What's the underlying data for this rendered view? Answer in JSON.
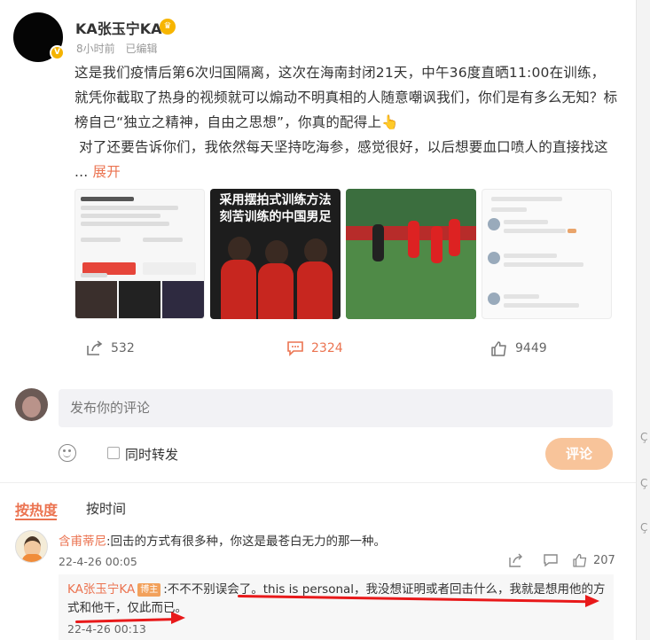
{
  "post": {
    "author": "KA张玉宁KA",
    "time": "8小时前",
    "edited": "已编辑",
    "paragraph1": "这是我们疫情后第6次归国隔离，这次在海南封闭21天，中午36度直晒11:00在训练，就凭你截取了热身的视频就可以煽动不明真相的人随意嘲讽我们，你们是有多么无知？标榜自己“独立之精神，自由之思想”，你真的配得上👆",
    "paragraph2": "对了还要告诉你们，我依然每天坚持吃海参，感觉很好，以后想要血口喷人的直接找这",
    "ellipsis": "...",
    "expand_label": "展开"
  },
  "thumbnails": {
    "thumb2_caption": "采用摆拍式训练方法 刻苦训练的中国男足"
  },
  "actions": {
    "forward_count": "532",
    "comment_count": "2324",
    "like_count": "9449"
  },
  "composer": {
    "placeholder": "发布你的评论",
    "repost_label": "同时转发",
    "submit_label": "评论"
  },
  "sort": {
    "hot": "按热度",
    "time": "按时间"
  },
  "comment": {
    "name": "含甫蒂尼",
    "text": ":回击的方式有很多种，你这是最苍白无力的那一种。",
    "time": "22-4-26 00:05",
    "like_count": "207"
  },
  "reply": {
    "name": "KA张玉宁KA",
    "badge": "博主",
    "text": ":不不不别误会了。this is personal，我没想证明或者回击什么，我就是想用他的方式和他干，仅此而已。",
    "time": "22-4-26 00:13"
  },
  "colors": {
    "accent": "#eb7350",
    "annotation_red": "#e8191a",
    "submit_disabled": "#f8c49a"
  },
  "icons": [
    "verified-badge-icon",
    "crown-emoji-icon",
    "forward-icon",
    "comment-icon",
    "like-icon",
    "emoji-icon",
    "share-icon",
    "reply-icon"
  ]
}
